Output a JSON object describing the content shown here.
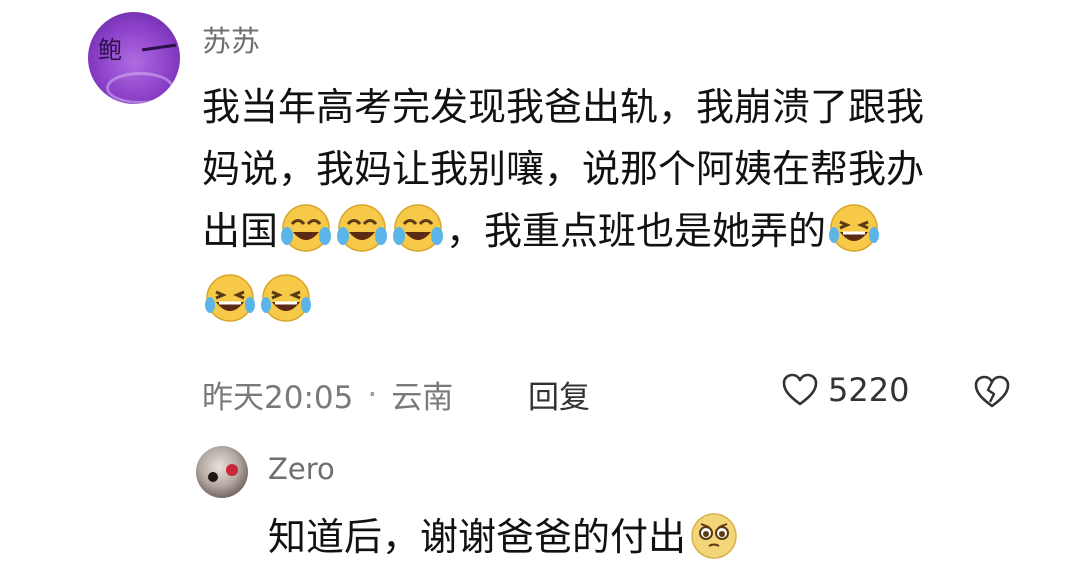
{
  "comment": {
    "username": "苏苏",
    "avatar_text": "鲍",
    "content_lines": [
      "我当年高考完发现我爸出轨，我崩溃了跟我",
      "妈说，我妈让我别嚷，说那个阿姨在帮我办",
      "出国",
      "，我重点班也是她弄的"
    ],
    "timestamp": "昨天20:05",
    "separator": "·",
    "location": "云南",
    "reply_label": "回复",
    "like_count": "5220",
    "icons": {
      "like": "heart-outline-icon",
      "dislike": "broken-heart-icon",
      "emoji_cry_laugh": "tears-of-joy-emoji",
      "emoji_laugh": "grinning-laugh-emoji"
    }
  },
  "reply": {
    "username": "Zero",
    "content": "知道后，谢谢爸爸的付出",
    "emoji": "pleading-face-emoji"
  },
  "colors": {
    "emoji_yellow": "#f7c948",
    "avatar_purple": "#8a3fc8",
    "meta_gray": "#7a7a7a"
  }
}
